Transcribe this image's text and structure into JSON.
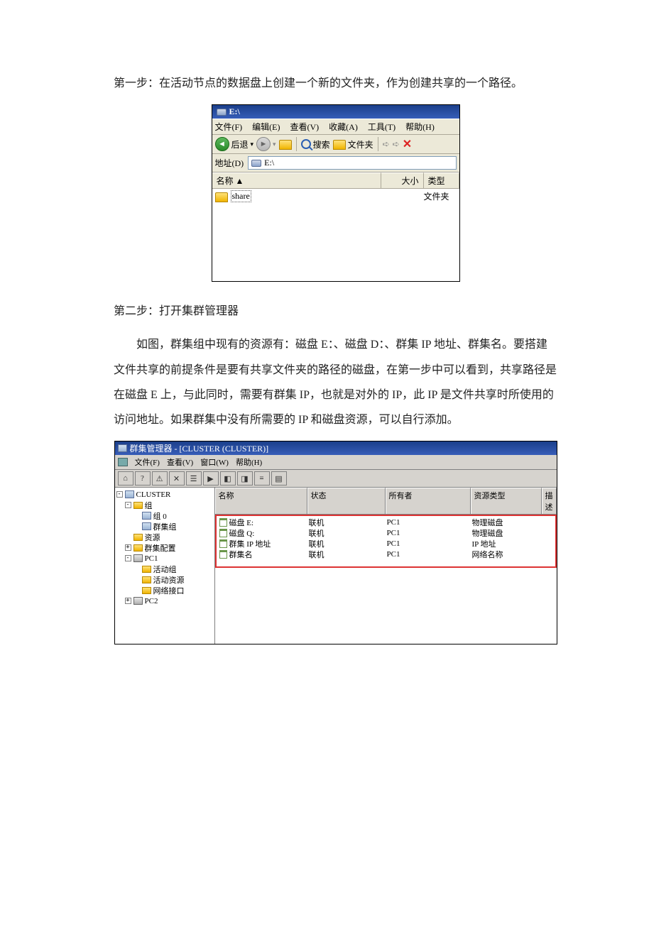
{
  "para1": "第一步：在活动节点的数据盘上创建一个新的文件夹，作为创建共享的一个路径。",
  "para2": "第二步：打开集群管理器",
  "para3": "如图，群集组中现有的资源有：磁盘 E：、磁盘 D：、群集 IP 地址、群集名。要搭建文件共享的前提条件是要有共享文件夹的路径的磁盘，在第一步中可以看到，共享路径是在磁盘 E 上，与此同时，需要有群集 IP，也就是对外的 IP，此 IP 是文件共享时所使用的访问地址。如果群集中没有所需要的 IP 和磁盘资源，可以自行添加。",
  "explorer": {
    "title": "E:\\",
    "menu": {
      "file": "文件(F)",
      "edit": "编辑(E)",
      "view": "查看(V)",
      "fav": "收藏(A)",
      "tools": "工具(T)",
      "help": "帮助(H)"
    },
    "toolbar": {
      "back": "后退",
      "search": "搜索",
      "folders": "文件夹"
    },
    "address_label": "地址(D)",
    "address_value": "E:\\",
    "columns": {
      "name": "名称 ▲",
      "size": "大小",
      "type": "类型"
    },
    "item": {
      "name": "share",
      "type": "文件夹"
    }
  },
  "cluster": {
    "title": "群集管理器 - [CLUSTER (CLUSTER)]",
    "menu": {
      "file": "文件(F)",
      "view": "查看(V)",
      "window": "窗口(W)",
      "help": "帮助(H)"
    },
    "tree": {
      "root": "CLUSTER",
      "groups": "组",
      "group0": "组 0",
      "cluster_group": "群集组",
      "resources": "资源",
      "cluster_config": "群集配置",
      "pc1": "PC1",
      "active_groups": "活动组",
      "active_resources": "活动资源",
      "network_interfaces": "网络接口",
      "pc2": "PC2"
    },
    "columns": {
      "name": "名称",
      "state": "状态",
      "owner": "所有者",
      "type": "资源类型",
      "desc": "描述"
    },
    "rows": [
      {
        "name": "磁盘 E:",
        "state": "联机",
        "owner": "PC1",
        "type": "物理磁盘"
      },
      {
        "name": "磁盘 Q:",
        "state": "联机",
        "owner": "PC1",
        "type": "物理磁盘"
      },
      {
        "name": "群集 IP 地址",
        "state": "联机",
        "owner": "PC1",
        "type": "IP 地址"
      },
      {
        "name": "群集名",
        "state": "联机",
        "owner": "PC1",
        "type": "网络名称"
      }
    ]
  }
}
